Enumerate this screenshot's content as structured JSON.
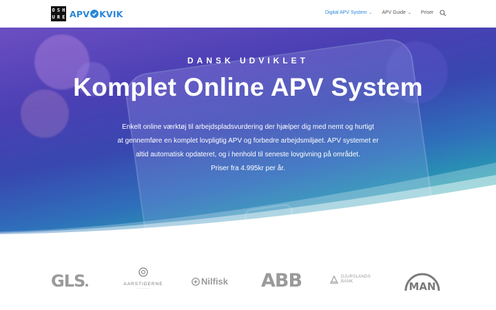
{
  "header": {
    "logo": {
      "mark_letters": [
        "O",
        "S",
        "H",
        "U",
        "R",
        "E"
      ],
      "brand_left": "APV",
      "brand_right": "KVIK"
    },
    "nav": [
      {
        "label": "Digital APV System",
        "has_dropdown": true,
        "active": true
      },
      {
        "label": "APV Guide",
        "has_dropdown": true,
        "active": false
      },
      {
        "label": "Priser",
        "has_dropdown": false,
        "active": false
      }
    ],
    "search_icon": "search-icon"
  },
  "hero": {
    "tagline": "DANSK UDVIKLET",
    "title": "Komplet Online APV System",
    "description_lines": [
      "Enkelt online værktøj til arbejdspladsvurdering der hjælper dig med nemt og hurtigt",
      "at gennemføre en komplet lovpligtig APV og forbedre arbejdsmiljøet. APV systemet er",
      "altid automatisk opdateret, og i henhold til seneste lovgivning på området.",
      "Priser fra 4.995kr per år."
    ]
  },
  "clients": {
    "gls": "GLS",
    "aarstiderne": {
      "name": "AARSTIDERNE"
    },
    "nilfisk": "Nilfisk",
    "abb": "ABB",
    "djurslands": {
      "line1": "DJURSLANDS",
      "line2": "BANK"
    },
    "man": "MAN"
  },
  "colors": {
    "accent": "#2b87da",
    "nav_text": "#555555",
    "logo_gray": "#9a9a9a"
  }
}
